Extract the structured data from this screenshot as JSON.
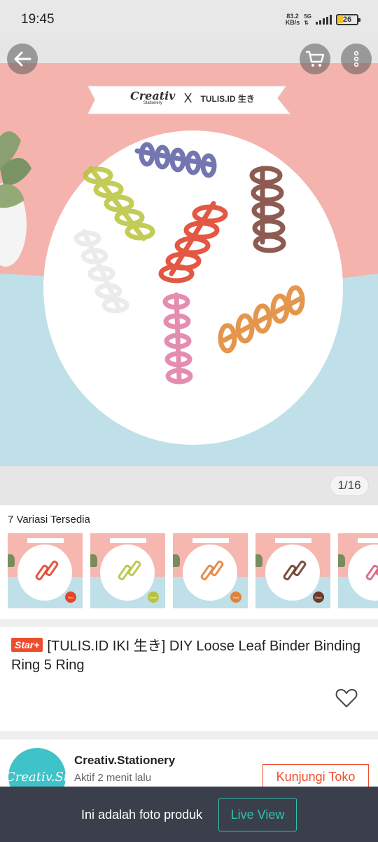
{
  "status_bar": {
    "time": "19:45",
    "net_speed_value": "83.2",
    "net_speed_unit": "KB/s",
    "network": "5G",
    "battery": "26",
    "battery_level": 0.26
  },
  "header": {
    "back_icon": "arrow-left-icon",
    "cart_icon": "cart-icon",
    "more_icon": "more-vertical-icon"
  },
  "gallery": {
    "counter": "1/16",
    "banner_brand": "Creativ",
    "banner_brand_sub": "Stationery",
    "banner_x": "X",
    "banner_partner": "TULIS.ID 生き"
  },
  "variations": {
    "title": "7 Variasi Tersedia",
    "items": [
      {
        "color": "#e2452c",
        "badge": "Red"
      },
      {
        "color": "#b8c23c",
        "badge": "Green"
      },
      {
        "color": "#e0823a",
        "badge": "Gold"
      },
      {
        "color": "#6e3b2a",
        "badge": "Black"
      },
      {
        "color": "#d9607e",
        "badge": ""
      }
    ]
  },
  "product": {
    "badge": "Star+",
    "title": "[TULIS.ID IKI 生き] DIY Loose Leaf Binder Binding Ring 5 Ring",
    "favorite_icon": "heart-outline-icon"
  },
  "shop": {
    "avatar_text": "Creativ.St",
    "name": "Creativ.Stationery",
    "status": "Aktif 2 menit lalu",
    "visit_label": "Kunjungi Toko"
  },
  "bottom_bar": {
    "message": "Ini adalah foto produk",
    "live_label": "Live View"
  },
  "colors": {
    "brand_orange": "#ee4d2d",
    "live_teal": "#2fc3b0",
    "bottom_bar": "#3a3f4b"
  }
}
